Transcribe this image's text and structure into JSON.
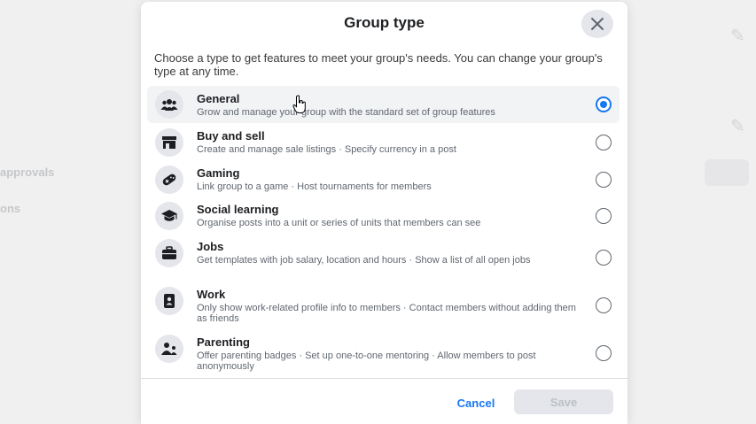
{
  "background": {
    "left_items": [
      "approvals",
      "ons"
    ]
  },
  "dialog": {
    "title": "Group type",
    "description": "Choose a type to get features to meet your group's needs. You can change your group's type at any time.",
    "options": [
      {
        "title": "General",
        "description": "Grow and manage your group with the standard set of group features",
        "selected": true,
        "icon": "people-icon"
      },
      {
        "title": "Buy and sell",
        "description": "Create and manage sale listings · Specify currency in a post",
        "selected": false,
        "icon": "shop-icon"
      },
      {
        "title": "Gaming",
        "description": "Link group to a game · Host tournaments for members",
        "selected": false,
        "icon": "game-controller-icon"
      },
      {
        "title": "Social learning",
        "description": "Organise posts into a unit or series of units that members can see",
        "selected": false,
        "icon": "graduation-cap-icon"
      },
      {
        "title": "Jobs",
        "description": "Get templates with job salary, location and hours · Show a list of all open jobs",
        "selected": false,
        "icon": "briefcase-icon"
      },
      {
        "title": "Work",
        "description": "Only show work-related profile info to members · Contact members without adding them as friends",
        "selected": false,
        "icon": "id-badge-icon"
      },
      {
        "title": "Parenting",
        "description": "Offer parenting badges · Set up one-to-one mentoring · Allow members to post anonymously",
        "selected": false,
        "icon": "parent-child-icon"
      }
    ],
    "cancel_label": "Cancel",
    "save_label": "Save"
  },
  "colors": {
    "accent": "#1877f2",
    "disabled_button": "#e4e6eb"
  }
}
